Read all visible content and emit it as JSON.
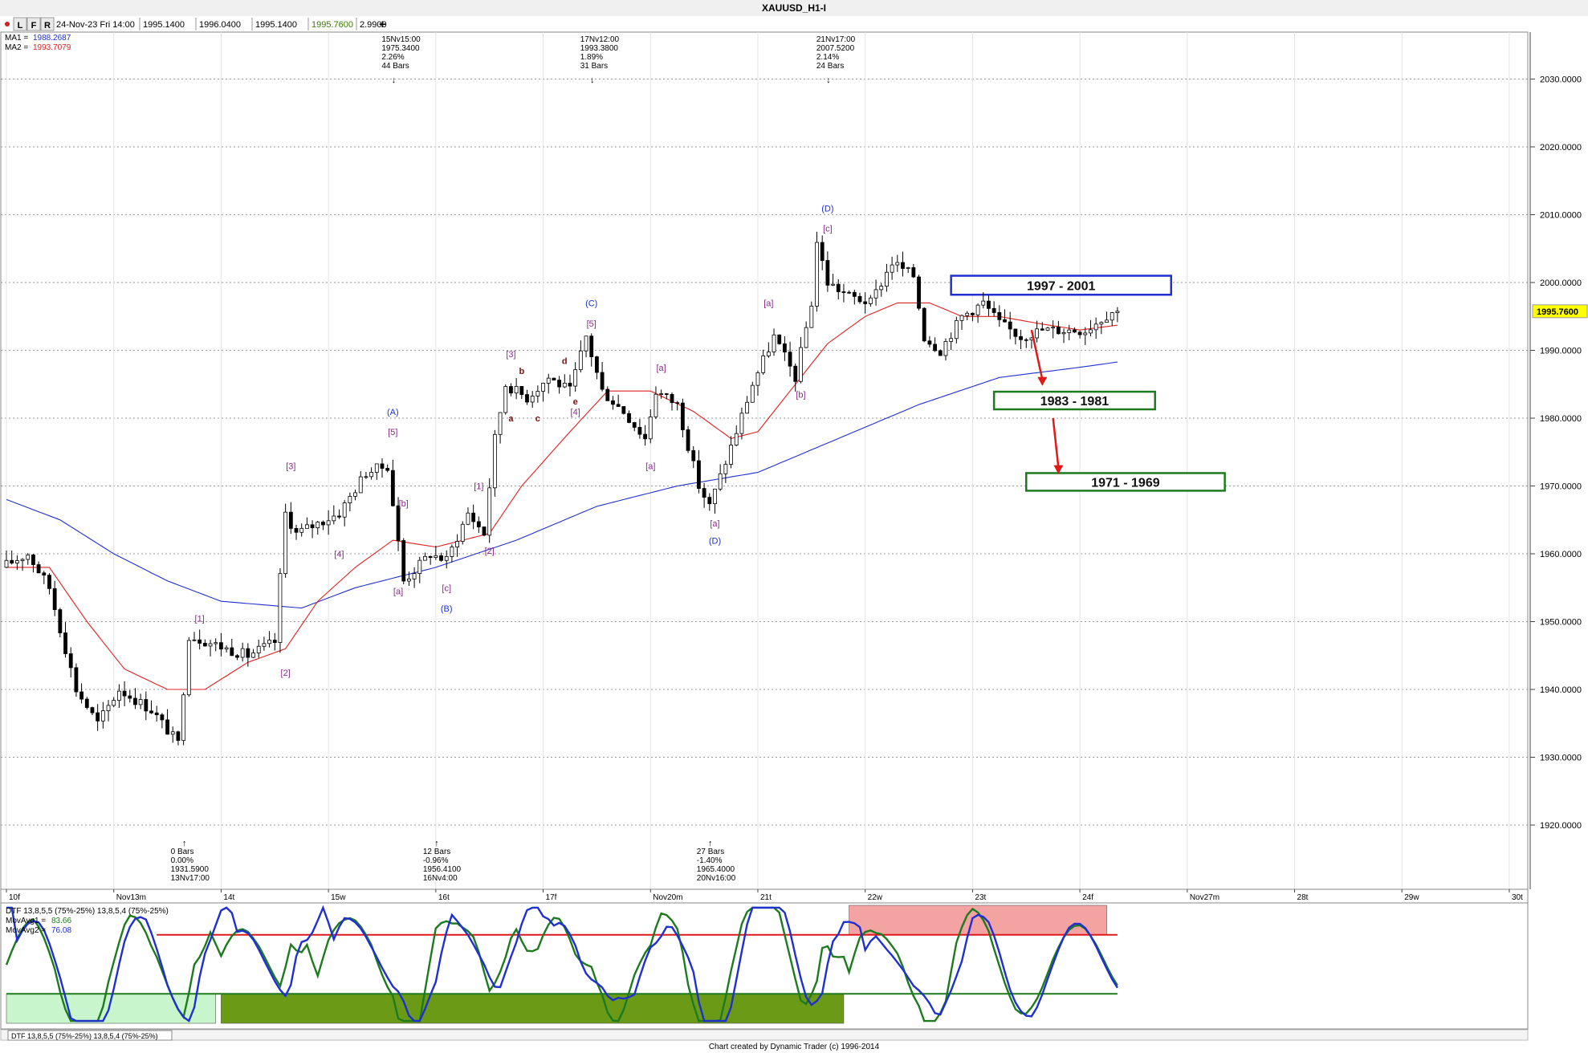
{
  "window": {
    "title": "XAUUSD_H1-I",
    "toolbar_buttons": [
      "L",
      "F",
      "R"
    ],
    "plus_label": "+",
    "ohlc_header": [
      "24-Nov-23 Fri 14:00",
      "1995.1400",
      "1996.0400",
      "1995.1400",
      "1995.7600",
      "2.9900"
    ],
    "ma_labels": [
      {
        "name": "MA1 =",
        "value": "1988.2687",
        "color": "#1f2fd0"
      },
      {
        "name": "MA2 =",
        "value": "1993.7079",
        "color": "#e02020"
      }
    ],
    "footer": "Chart created by Dynamic Trader  (c)  1996-2014"
  },
  "chart_data": {
    "type": "candlestick",
    "price_axis": {
      "ylim": [
        1910,
        2040
      ],
      "ticks": [
        "1920.0000",
        "1930.0000",
        "1940.0000",
        "1950.0000",
        "1960.0000",
        "1970.0000",
        "1980.0000",
        "1990.0000",
        "2000.0000",
        "2010.0000",
        "2020.0000",
        "2030.0000"
      ],
      "tick_values": [
        1920,
        1930,
        1940,
        1950,
        1960,
        1970,
        1980,
        1990,
        2000,
        2010,
        2020,
        2030
      ],
      "last_price": "1995.7600",
      "last_price_value": 1995.76
    },
    "time_axis": {
      "labels": [
        "10f",
        "Nov13m",
        "14t",
        "15w",
        "16t",
        "17f",
        "Nov20m",
        "21t",
        "22w",
        "23t",
        "24f",
        "Nov27m",
        "28t",
        "29w",
        "30t"
      ],
      "label_bars": [
        0,
        20,
        40,
        60,
        80,
        100,
        120,
        140,
        160,
        180,
        200,
        220,
        240,
        260,
        280
      ],
      "total_bars": 283,
      "last_bar": 207
    },
    "price_path": [
      [
        0,
        1958
      ],
      [
        5,
        1960
      ],
      [
        9,
        1955
      ],
      [
        14,
        1940
      ],
      [
        18,
        1935
      ],
      [
        22,
        1940
      ],
      [
        28,
        1937
      ],
      [
        33,
        1932
      ],
      [
        35,
        1948
      ],
      [
        42,
        1946
      ],
      [
        46,
        1945
      ],
      [
        51,
        1947
      ],
      [
        53,
        1966
      ],
      [
        55,
        1963
      ],
      [
        63,
        1966
      ],
      [
        68,
        1972
      ],
      [
        72,
        1973
      ],
      [
        75,
        1956
      ],
      [
        80,
        1960
      ],
      [
        83,
        1959
      ],
      [
        87,
        1966
      ],
      [
        90,
        1963
      ],
      [
        92,
        1977
      ],
      [
        94,
        1985
      ],
      [
        98,
        1983
      ],
      [
        102,
        1986
      ],
      [
        106,
        1984
      ],
      [
        109,
        1992
      ],
      [
        112,
        1984
      ],
      [
        116,
        1981
      ],
      [
        120,
        1977
      ],
      [
        122,
        1984
      ],
      [
        126,
        1982
      ],
      [
        130,
        1970
      ],
      [
        132,
        1967
      ],
      [
        137,
        1978
      ],
      [
        140,
        1985
      ],
      [
        144,
        1992
      ],
      [
        148,
        1986
      ],
      [
        151,
        1997
      ],
      [
        152,
        2006
      ],
      [
        154,
        2000
      ],
      [
        158,
        1998
      ],
      [
        162,
        1997
      ],
      [
        166,
        2003
      ],
      [
        170,
        2001
      ],
      [
        172,
        1992
      ],
      [
        175,
        1990
      ],
      [
        179,
        1995
      ],
      [
        183,
        1997
      ],
      [
        186,
        1994
      ],
      [
        190,
        1992
      ],
      [
        194,
        1993
      ],
      [
        198,
        1993
      ],
      [
        202,
        1993
      ],
      [
        207,
        1995.76
      ]
    ],
    "moving_averages": [
      {
        "name": "MA1",
        "value": "1988.2687",
        "color": "#1f2fd0",
        "path": [
          [
            0,
            1968
          ],
          [
            10,
            1965
          ],
          [
            20,
            1960
          ],
          [
            30,
            1956
          ],
          [
            40,
            1953
          ],
          [
            55,
            1952
          ],
          [
            65,
            1955
          ],
          [
            80,
            1958
          ],
          [
            95,
            1962
          ],
          [
            110,
            1967
          ],
          [
            125,
            1970
          ],
          [
            140,
            1972
          ],
          [
            155,
            1977
          ],
          [
            170,
            1982
          ],
          [
            185,
            1986
          ],
          [
            200,
            1987.5
          ],
          [
            207,
            1988.27
          ]
        ]
      },
      {
        "name": "MA2",
        "value": "1993.7079",
        "color": "#e02020",
        "path": [
          [
            0,
            1958
          ],
          [
            8,
            1958
          ],
          [
            15,
            1950
          ],
          [
            22,
            1943
          ],
          [
            30,
            1940
          ],
          [
            37,
            1940
          ],
          [
            45,
            1944
          ],
          [
            52,
            1946
          ],
          [
            58,
            1953
          ],
          [
            65,
            1958
          ],
          [
            72,
            1962
          ],
          [
            80,
            1961
          ],
          [
            90,
            1963
          ],
          [
            96,
            1970
          ],
          [
            105,
            1978
          ],
          [
            112,
            1984
          ],
          [
            120,
            1984
          ],
          [
            128,
            1981
          ],
          [
            135,
            1977
          ],
          [
            140,
            1978
          ],
          [
            147,
            1985
          ],
          [
            153,
            1991
          ],
          [
            160,
            1995
          ],
          [
            166,
            1997
          ],
          [
            172,
            1997
          ],
          [
            178,
            1995
          ],
          [
            185,
            1995
          ],
          [
            192,
            1994
          ],
          [
            200,
            1993
          ],
          [
            207,
            1993.71
          ]
        ]
      }
    ],
    "zones": [
      {
        "label": "1997 - 2001",
        "low": 1998.2,
        "high": 2001,
        "bar_start": 176,
        "bar_end": 217,
        "color": "#1f2fd0"
      },
      {
        "label": "1983 - 1981",
        "low": 1981.3,
        "high": 1983.9,
        "bar_start": 184,
        "bar_end": 214,
        "color": "#1e7a1e"
      },
      {
        "label": "1971 - 1969",
        "low": 1969.3,
        "high": 1971.9,
        "bar_start": 190,
        "bar_end": 227,
        "color": "#1e7a1e"
      }
    ],
    "arrows": [
      {
        "from": [
          191,
          1993
        ],
        "to": [
          193,
          1985
        ]
      },
      {
        "from": [
          195,
          1980
        ],
        "to": [
          196,
          1972
        ]
      }
    ],
    "wave_labels": [
      {
        "text": "[1]",
        "bar": 36,
        "price": 1950,
        "color": "#8a2b8a"
      },
      {
        "text": "[2]",
        "bar": 52,
        "price": 1942,
        "color": "#8a2b8a"
      },
      {
        "text": "[3]",
        "bar": 53,
        "price": 1972.5,
        "color": "#8a2b8a"
      },
      {
        "text": "[4]",
        "bar": 62,
        "price": 1959.5,
        "color": "#8a2b8a"
      },
      {
        "text": "(A)",
        "bar": 72,
        "price": 1980.5,
        "color": "#1f2fd0"
      },
      {
        "text": "[5]",
        "bar": 72,
        "price": 1977.5,
        "color": "#8a2b8a"
      },
      {
        "text": "[b]",
        "bar": 74,
        "price": 1967,
        "color": "#8a2b8a"
      },
      {
        "text": "[a]",
        "bar": 73,
        "price": 1954,
        "color": "#8a2b8a"
      },
      {
        "text": "[c]",
        "bar": 82,
        "price": 1954.5,
        "color": "#8a2b8a"
      },
      {
        "text": "(B)",
        "bar": 82,
        "price": 1951.5,
        "color": "#1f2fd0"
      },
      {
        "text": "[1]",
        "bar": 88,
        "price": 1969.5,
        "color": "#8a2b8a"
      },
      {
        "text": "[2]",
        "bar": 90,
        "price": 1960,
        "color": "#8a2b8a"
      },
      {
        "text": "[3]",
        "bar": 94,
        "price": 1989,
        "color": "#8a2b8a"
      },
      {
        "text": "b",
        "bar": 96,
        "price": 1986.5,
        "color": "#7a1010"
      },
      {
        "text": "a",
        "bar": 94,
        "price": 1979.5,
        "color": "#7a1010"
      },
      {
        "text": "c",
        "bar": 99,
        "price": 1979.5,
        "color": "#7a1010"
      },
      {
        "text": "d",
        "bar": 104,
        "price": 1988,
        "color": "#7a1010"
      },
      {
        "text": "e",
        "bar": 106,
        "price": 1982,
        "color": "#7a1010"
      },
      {
        "text": "[4]",
        "bar": 106,
        "price": 1980.5,
        "color": "#8a2b8a"
      },
      {
        "text": "(C)",
        "bar": 109,
        "price": 1996.5,
        "color": "#1f2fd0"
      },
      {
        "text": "[5]",
        "bar": 109,
        "price": 1993.5,
        "color": "#8a2b8a"
      },
      {
        "text": "[a]",
        "bar": 122,
        "price": 1987,
        "color": "#8a2b8a"
      },
      {
        "text": "[a]",
        "bar": 120,
        "price": 1972.5,
        "color": "#8a2b8a"
      },
      {
        "text": "[a]",
        "bar": 132,
        "price": 1964,
        "color": "#8a2b8a"
      },
      {
        "text": "(D)",
        "bar": 132,
        "price": 1961.5,
        "color": "#1f2fd0"
      },
      {
        "text": "[a]",
        "bar": 142,
        "price": 1996.5,
        "color": "#8a2b8a"
      },
      {
        "text": "[b]",
        "bar": 148,
        "price": 1983,
        "color": "#8a2b8a"
      },
      {
        "text": "(D)",
        "bar": 153,
        "price": 2010.5,
        "color": "#1f2fd0"
      },
      {
        "text": "[c]",
        "bar": 153,
        "price": 2007.5,
        "color": "#8a2b8a"
      }
    ],
    "top_annotations": [
      {
        "bar": 72,
        "lines": [
          "15Nv15:00",
          "1975.3400",
          "2.26%",
          "44 Bars"
        ]
      },
      {
        "bar": 109,
        "lines": [
          "17Nv12:00",
          "1993.3800",
          "1.89%",
          "31 Bars"
        ]
      },
      {
        "bar": 153,
        "lines": [
          "21Nv17:00",
          "2007.5200",
          "2.14%",
          "24 Bars"
        ]
      }
    ],
    "bottom_annotations": [
      {
        "bar": 33,
        "lines": [
          "0 Bars",
          "0.00%",
          "1931.5900",
          "13Nv17:00"
        ]
      },
      {
        "bar": 80,
        "lines": [
          "12 Bars",
          "-0.96%",
          "1956.4100",
          "16Nv4:00"
        ]
      },
      {
        "bar": 131,
        "lines": [
          "27 Bars",
          "-1.40%",
          "1965.4000",
          "20Nv16:00"
        ]
      }
    ],
    "oscillator": {
      "title": "DTF 13,8,5,5 (75%-25%) 13,8,5,4 (75%-25%)",
      "mov_avg_labels": [
        {
          "name": "MovAvg1 =",
          "value": "83.66",
          "color": "#1e7a1e"
        },
        {
          "name": "MovAvg2 =",
          "value": "76.08",
          "color": "#1f2fd0"
        }
      ],
      "ylim": [
        0,
        100
      ],
      "upper_level": 75,
      "lower_level": 25,
      "tab_label": "DTF 13,8,5,5 (75%-25%) 13,8,5,4 (75%-25%)",
      "zones": [
        {
          "bar_start": 0,
          "bar_end": 39,
          "low": 0,
          "high": 25,
          "color": "#c9f5cc"
        },
        {
          "bar_start": 40,
          "bar_end": 156,
          "low": 0,
          "high": 25,
          "color": "#6a9a16"
        },
        {
          "bar_start": 157,
          "bar_end": 205,
          "low": 75,
          "high": 100,
          "color": "#f4a3a3"
        }
      ],
      "fast_line_color": "#1e7a1e",
      "slow_line_color": "#1f2fd0"
    }
  }
}
